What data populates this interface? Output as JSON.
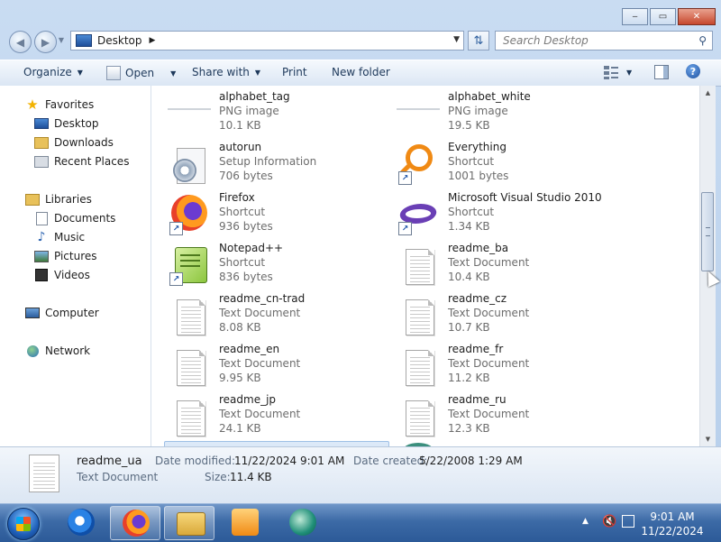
{
  "address": {
    "location": "Desktop"
  },
  "search": {
    "placeholder": "Search Desktop"
  },
  "window_controls": {
    "minimize": "‒",
    "maximize": "▭",
    "close": "✕"
  },
  "toolbar": {
    "organize": "Organize",
    "open": "Open",
    "share_with": "Share with",
    "print": "Print",
    "new_folder": "New folder",
    "help": "?"
  },
  "nav": {
    "favorites": "Favorites",
    "desktop": "Desktop",
    "downloads": "Downloads",
    "recent_places": "Recent Places",
    "libraries": "Libraries",
    "documents": "Documents",
    "music": "Music",
    "pictures": "Pictures",
    "videos": "Videos",
    "computer": "Computer",
    "network": "Network"
  },
  "files": [
    {
      "name": "alphabet_tag",
      "type": "PNG image",
      "size": "10.1 KB",
      "icon": "png-thumbnail"
    },
    {
      "name": "alphabet_white",
      "type": "PNG image",
      "size": "19.5 KB",
      "icon": "png-thumbnail"
    },
    {
      "name": "autorun",
      "type": "Setup Information",
      "size": "706 bytes",
      "icon": "setup-gear-icon"
    },
    {
      "name": "Everything",
      "type": "Shortcut",
      "size": "1001 bytes",
      "icon": "everything-icon"
    },
    {
      "name": "Firefox",
      "type": "Shortcut",
      "size": "936 bytes",
      "icon": "firefox-icon"
    },
    {
      "name": "Microsoft Visual Studio 2010",
      "type": "Shortcut",
      "size": "1.34 KB",
      "icon": "visual-studio-icon"
    },
    {
      "name": "Notepad++",
      "type": "Shortcut",
      "size": "836 bytes",
      "icon": "notepad-plus-plus-icon"
    },
    {
      "name": "readme_ba",
      "type": "Text Document",
      "size": "10.4 KB",
      "icon": "text-document-icon"
    },
    {
      "name": "readme_cn-trad",
      "type": "Text Document",
      "size": "8.08 KB",
      "icon": "text-document-icon"
    },
    {
      "name": "readme_cz",
      "type": "Text Document",
      "size": "10.7 KB",
      "icon": "text-document-icon"
    },
    {
      "name": "readme_en",
      "type": "Text Document",
      "size": "9.95 KB",
      "icon": "text-document-icon"
    },
    {
      "name": "readme_fr",
      "type": "Text Document",
      "size": "11.2 KB",
      "icon": "text-document-icon"
    },
    {
      "name": "readme_jp",
      "type": "Text Document",
      "size": "24.1 KB",
      "icon": "text-document-icon"
    },
    {
      "name": "readme_ru",
      "type": "Text Document",
      "size": "12.3 KB",
      "icon": "text-document-icon"
    }
  ],
  "details": {
    "name": "readme_ua",
    "type": "Text Document",
    "modified_label": "Date modified:",
    "modified_value": "11/22/2024 9:01 AM",
    "size_label": "Size:",
    "size_value": "11.4 KB",
    "created_label": "Date created:",
    "created_value": "5/22/2008 1:29 AM"
  },
  "taskbar": {
    "time": "9:01 AM",
    "date": "11/22/2024",
    "apps": [
      "internet-explorer-icon",
      "firefox-icon",
      "windows-explorer-icon",
      "media-player-icon",
      "app-icon"
    ]
  }
}
